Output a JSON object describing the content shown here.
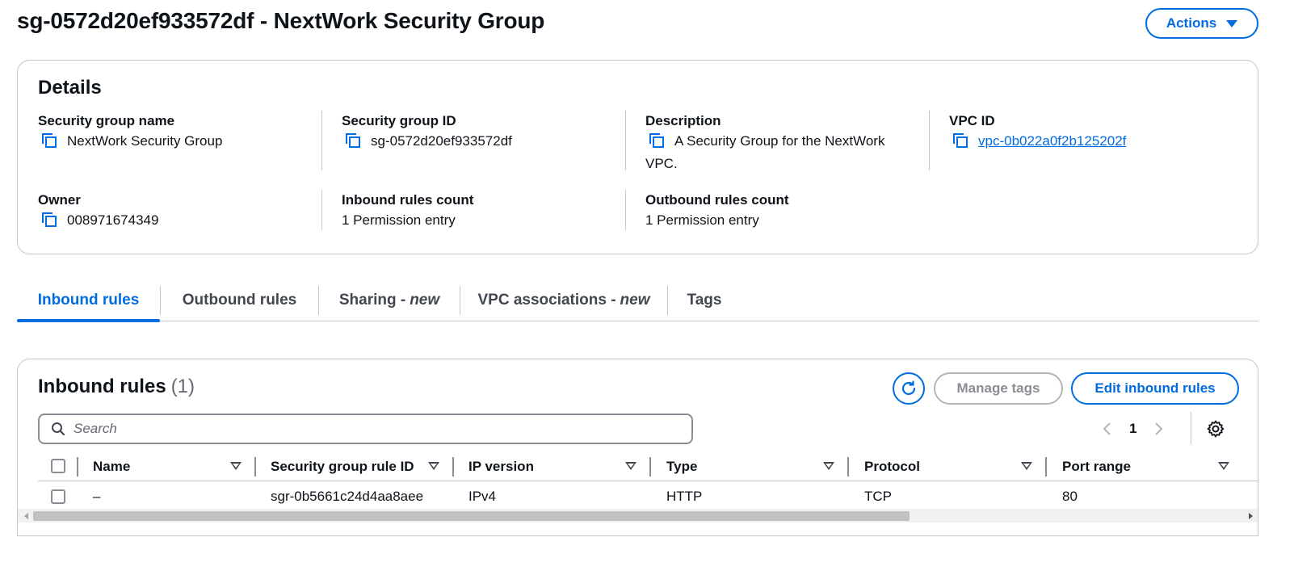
{
  "header": {
    "title": "sg-0572d20ef933572df - NextWork Security Group",
    "actions_label": "Actions"
  },
  "details": {
    "title": "Details",
    "security_group_name_label": "Security group name",
    "security_group_name": "NextWork Security Group",
    "security_group_id_label": "Security group ID",
    "security_group_id": "sg-0572d20ef933572df",
    "description_label": "Description",
    "description": "A Security Group for the NextWork VPC.",
    "vpc_id_label": "VPC ID",
    "vpc_id": "vpc-0b022a0f2b125202f",
    "owner_label": "Owner",
    "owner": "008971674349",
    "inbound_count_label": "Inbound rules count",
    "inbound_count": "1 Permission entry",
    "outbound_count_label": "Outbound rules count",
    "outbound_count": "1 Permission entry"
  },
  "tabs": [
    {
      "label": "Inbound rules",
      "suffix": ""
    },
    {
      "label": "Outbound rules",
      "suffix": ""
    },
    {
      "label": "Sharing -",
      "suffix": "new"
    },
    {
      "label": "VPC associations -",
      "suffix": "new"
    },
    {
      "label": "Tags",
      "suffix": ""
    }
  ],
  "inbound": {
    "title": "Inbound rules",
    "count": "(1)",
    "manage_tags_label": "Manage tags",
    "edit_label": "Edit inbound rules",
    "search_placeholder": "Search",
    "page": "1",
    "columns": [
      "Name",
      "Security group rule ID",
      "IP version",
      "Type",
      "Protocol",
      "Port range"
    ],
    "rows": [
      {
        "name": "–",
        "rule_id": "sgr-0b5661c24d4aa8aee",
        "ip_version": "IPv4",
        "type": "HTTP",
        "protocol": "TCP",
        "port_range": "80"
      }
    ]
  },
  "colors": {
    "accent": "#006ce0",
    "border": "#c6c6cd",
    "text": "#0f141a"
  }
}
